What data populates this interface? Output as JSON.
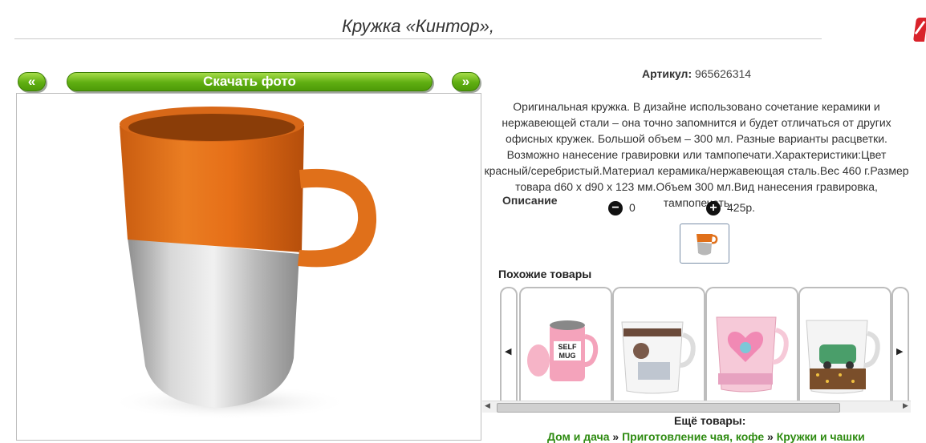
{
  "product": {
    "title": "Кружка «Кинтор»,",
    "sku_label": "Артикул:",
    "sku_value": "965626314",
    "description": "Оригинальная кружка. В дизайне использовано сочетание керамики и нержавеющей стали – она точно запомнится и будет отличаться от других офисных кружек. Большой объем – 300 мл. Разные варианты расцветки. Возможно нанесение гравировки или тампопечати.Характеристики:Цвет красный/серебристый.Материал керамика/нержавеющая сталь.Вес 460 г.Размер товара d60 x d90 x 123 мм.Объем 300 мл.Вид нанесения гравировка, тампопечать",
    "description_label": "Описание",
    "quantity": "0",
    "price": "425р."
  },
  "gallery": {
    "prev_label": "«",
    "next_label": "»",
    "download_label": "Скачать фото"
  },
  "related": {
    "title": "Похожие товары",
    "items": [
      {
        "name": "self-stirring-mug"
      },
      {
        "name": "bonbon-mug"
      },
      {
        "name": "pink-heart-mug"
      },
      {
        "name": "retro-car-mug"
      }
    ]
  },
  "more": {
    "title": "Ещё товары:",
    "crumbs": [
      "Дом и дача",
      "Приготовление чая, кофе",
      "Кружки и чашки"
    ],
    "separator": "»"
  },
  "colors": {
    "accent_green": "#5fae11",
    "mug_orange": "#e0701a",
    "steel": "#b8b8b8"
  }
}
